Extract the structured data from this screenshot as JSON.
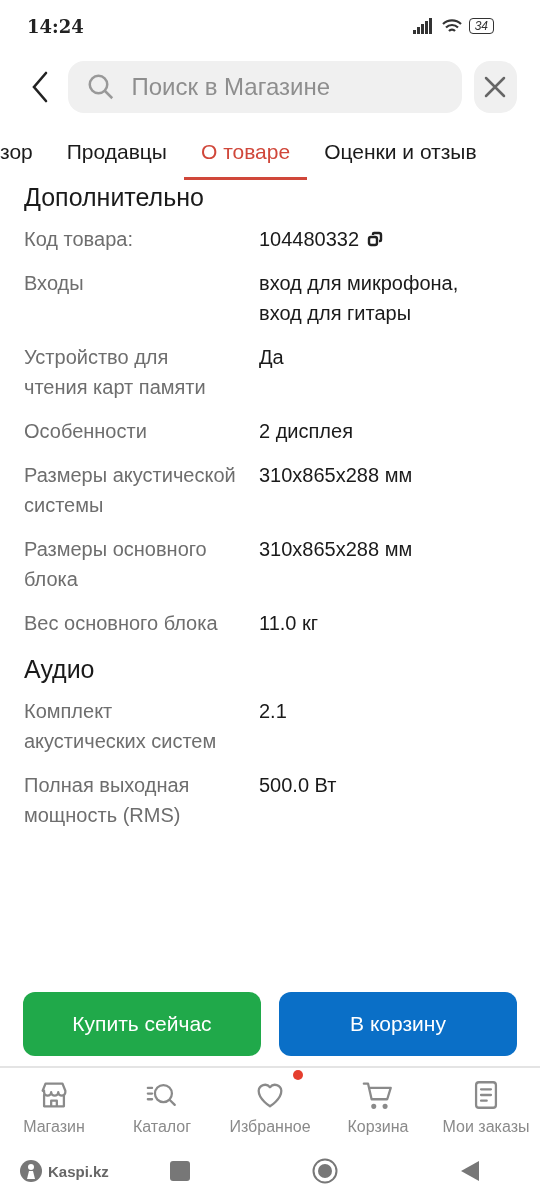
{
  "status_bar": {
    "time": "14:24",
    "battery": "34"
  },
  "search": {
    "placeholder": "Поиск в Магазине"
  },
  "tabs": [
    {
      "label": "зор",
      "selected": false
    },
    {
      "label": "Продавцы",
      "selected": false
    },
    {
      "label": "О товаре",
      "selected": true
    },
    {
      "label": "Оценки и отзыв",
      "selected": false
    }
  ],
  "sections": [
    {
      "title": "Дополнительно",
      "rows": [
        {
          "label": "Код товара:",
          "value": "104480332",
          "copyable": true
        },
        {
          "label": "Входы",
          "value": "вход для микрофона, вход для гитары"
        },
        {
          "label": "Устройство для чтения карт памяти",
          "value": "Да"
        },
        {
          "label": "Особенности",
          "value": "2 дисплея"
        },
        {
          "label": "Размеры акустической системы",
          "value": "310x865x288 мм"
        },
        {
          "label": "Размеры основного блока",
          "value": "310x865x288 мм"
        },
        {
          "label": "Вес основного блока",
          "value": "11.0 кг"
        }
      ]
    },
    {
      "title": "Аудио",
      "rows": [
        {
          "label": "Комплект акустических систем",
          "value": "2.1"
        },
        {
          "label": "Полная выходная мощность (RMS)",
          "value": "500.0 Вт"
        }
      ]
    }
  ],
  "actions": [
    {
      "label": "Купить сейчас",
      "kind": "buy"
    },
    {
      "label": "В корзину",
      "kind": "cart"
    }
  ],
  "nav": [
    {
      "label": "Магазин",
      "kind": "store",
      "badge": false
    },
    {
      "label": "Каталог",
      "kind": "catalog",
      "badge": false
    },
    {
      "label": "Избранное",
      "kind": "heart",
      "badge": true
    },
    {
      "label": "Корзина",
      "kind": "cart",
      "badge": false
    },
    {
      "label": "Мои заказы",
      "kind": "orders",
      "badge": false
    }
  ],
  "system_bar": {
    "brand": "Kaspi.kz"
  }
}
